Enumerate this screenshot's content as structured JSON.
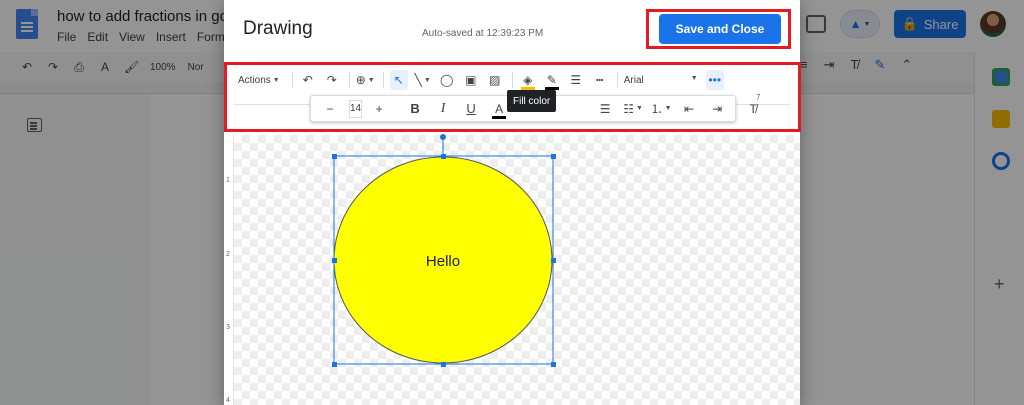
{
  "docs": {
    "title": "how to add fractions in go",
    "menu": [
      "File",
      "Edit",
      "View",
      "Insert",
      "Forma"
    ],
    "zoom": "100%",
    "style": "Nor",
    "share_label": "Share"
  },
  "dialog": {
    "title": "Drawing",
    "autosave": "Auto-saved at 12:39:23 PM",
    "save_label": "Save and Close"
  },
  "toolbar": {
    "actions_label": "Actions",
    "font": "Arial",
    "tooltip": "Fill color",
    "font_size": "14",
    "fill_color": "#fbbc04",
    "line_color": "#000000"
  },
  "ruler": {
    "h_mark": "7",
    "v_marks": [
      "1",
      "2",
      "3",
      "4"
    ]
  },
  "shape": {
    "text": "Hello",
    "fill": "#ffff00",
    "selection_color": "#1a73e8"
  },
  "colors": {
    "highlight_border": "#e31c23",
    "primary": "#1a73e8"
  }
}
